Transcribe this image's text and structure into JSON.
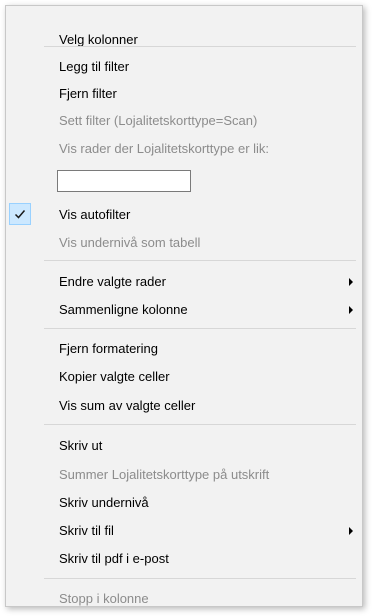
{
  "menu": {
    "choose_columns": "Velg kolonner",
    "add_filter": "Legg til filter",
    "remove_filter": "Fjern filter",
    "set_filter": "Sett filter (Lojalitetskorttype=Scan)",
    "show_rows_where": "Vis rader der Lojalitetskorttype er lik:",
    "filter_value": "",
    "show_autofilter": "Vis autofilter",
    "show_autofilter_checked": true,
    "show_sublevel_table": "Vis undernivå som tabell",
    "change_selected_rows": "Endre valgte rader",
    "compare_column": "Sammenligne kolonne",
    "remove_formatting": "Fjern formatering",
    "copy_selected_cells": "Kopier valgte celler",
    "show_sum_selected": "Vis sum av valgte celler",
    "print": "Skriv ut",
    "sum_on_printout": "Summer Lojalitetskorttype på utskrift",
    "print_sublevel": "Skriv undernivå",
    "print_to_file": "Skriv til fil",
    "print_pdf_email": "Skriv til pdf i e-post",
    "stop_in_column": "Stopp i kolonne"
  },
  "icons": {
    "checkmark": "checkmark-icon",
    "submenu_arrow": "chevron-right-icon"
  },
  "colors": {
    "menu_background": "#f2f2f2",
    "checked_highlight": "#cce8ff",
    "disabled_text": "#8c8c8c",
    "separator": "#d7d7d7"
  }
}
